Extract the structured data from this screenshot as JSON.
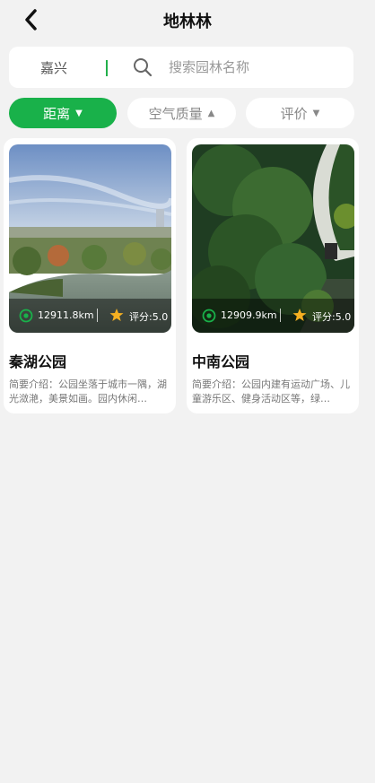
{
  "header": {
    "title": "地林林"
  },
  "search": {
    "city": "嘉兴",
    "placeholder": "搜索园林名称",
    "value": ""
  },
  "filters": [
    {
      "label": "距离",
      "active": true,
      "caret": "▼"
    },
    {
      "label": "空气质量",
      "active": false,
      "caret": "▲"
    },
    {
      "label": "评价",
      "active": false,
      "caret": "▼"
    }
  ],
  "parks": [
    {
      "name": "秦湖公园",
      "distance": "12911.8km",
      "rating": "评分:5.0",
      "intro": "简要介绍：公园坐落于城市一隅，湖光潋滟，美景如画。园内休闲…"
    },
    {
      "name": "中南公园",
      "distance": "12909.9km",
      "rating": "评分:5.0",
      "intro": "简要介绍：公园内建有运动广场、儿童游乐区、健身活动区等，绿…"
    }
  ],
  "colors": {
    "accent": "#19b14a",
    "star": "#f5b021",
    "background": "#f2f2f2"
  },
  "icons": {
    "back": "back-arrow-icon",
    "search": "search-icon",
    "location": "location-icon",
    "star": "star-icon"
  }
}
